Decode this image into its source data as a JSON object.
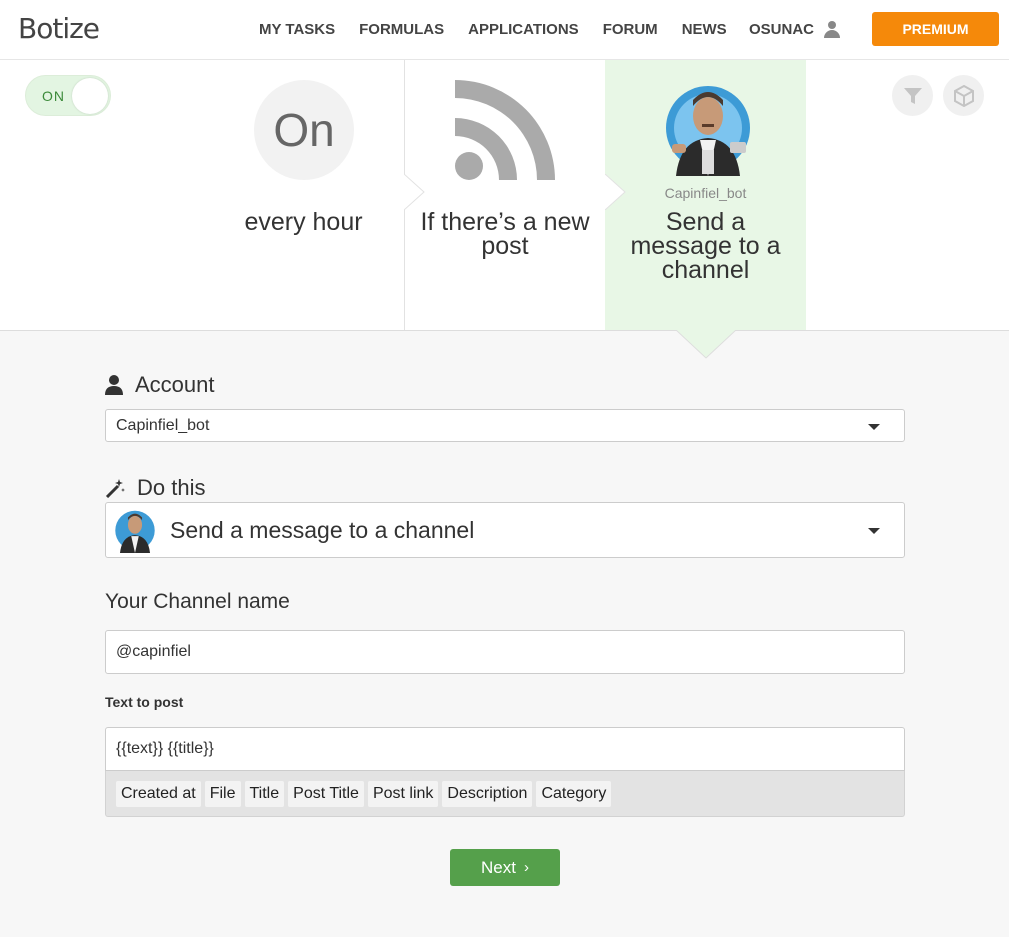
{
  "header": {
    "logo": "Botize",
    "nav": [
      "MY TASKS",
      "FORMULAS",
      "APPLICATIONS",
      "FORUM",
      "NEWS"
    ],
    "username": "OSUNAC",
    "premium_label": "PREMIUM"
  },
  "toggle": {
    "label": "ON"
  },
  "steps": {
    "trigger_icon_text": "On",
    "trigger_label": "every hour",
    "source_label": "If there’s a new post",
    "bot_name": "Capinfiel_bot",
    "action_label": "Send a message to a channel"
  },
  "form": {
    "account_title": "Account",
    "account_value": "Capinfiel_bot",
    "do_this_title": "Do this",
    "do_this_value": "Send a message to a channel",
    "channel_title": "Your Channel name",
    "channel_value": "@capinfiel",
    "text_label": "Text to post",
    "text_value": "{{text}} {{title}}",
    "tags": [
      "Created at",
      "File",
      "Title",
      "Post Title",
      "Post link",
      "Description",
      "Category"
    ],
    "next_label": "Next"
  },
  "colors": {
    "premium": "#f5890a",
    "next": "#55a04b",
    "active_step": "#e8f7e6"
  }
}
